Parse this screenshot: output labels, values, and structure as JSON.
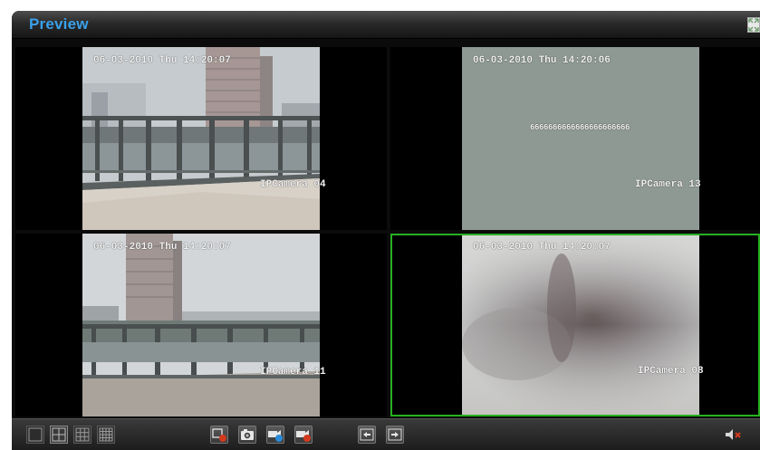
{
  "window": {
    "title": "Preview"
  },
  "panes": [
    {
      "id": "p1",
      "timestamp": "06-03-2010 Thu 14:20:07",
      "camera": "IPCamera 04",
      "message": "",
      "selected": false
    },
    {
      "id": "p2",
      "timestamp": "06-03-2010 Thu 14:20:06",
      "camera": "IPCamera 13",
      "message": "6666666666666666666666",
      "selected": false
    },
    {
      "id": "p3",
      "timestamp": "06-03-2010 Thu 14:20:07",
      "camera": "IPCamera 11",
      "message": "",
      "selected": false
    },
    {
      "id": "p4",
      "timestamp": "06-03-2010 Thu 14:20:07",
      "camera": "IPCamera 08",
      "message": "",
      "selected": true
    }
  ],
  "toolbar": {
    "layouts": [
      {
        "name": "layout-1-button",
        "icon": "single-screen-icon",
        "active": false
      },
      {
        "name": "layout-4-button",
        "icon": "quad-screen-icon",
        "active": true
      },
      {
        "name": "layout-9-button",
        "icon": "nine-screen-icon",
        "active": false
      },
      {
        "name": "layout-16-button",
        "icon": "sixteen-screen-icon",
        "active": false
      }
    ],
    "actions": [
      {
        "name": "stop-all-preview-button",
        "icon": "stop-preview-icon"
      },
      {
        "name": "snapshot-button",
        "icon": "camera-icon"
      },
      {
        "name": "start-recording-button",
        "icon": "record-start-icon"
      },
      {
        "name": "stop-recording-button",
        "icon": "record-stop-icon"
      },
      {
        "name": "previous-page-button",
        "icon": "arrow-left-icon"
      },
      {
        "name": "next-page-button",
        "icon": "arrow-right-icon"
      }
    ],
    "audio_icon": "speaker-muted-icon"
  },
  "colors": {
    "accent": "#3aa0ea",
    "selected_border": "#27b020",
    "record_red": "#d23a1e"
  }
}
